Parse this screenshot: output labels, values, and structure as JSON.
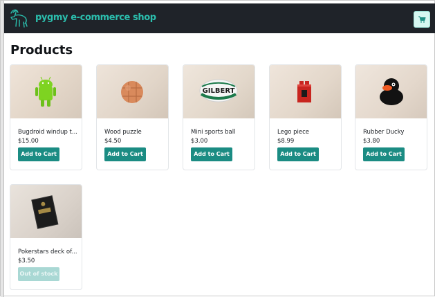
{
  "navbar": {
    "brand": "pygmy e-commerce shop",
    "logo_icon": "goat-logo-icon",
    "cart_icon": "shopping-cart-icon",
    "accent": "#2bbfae",
    "background": "#1f2329"
  },
  "page": {
    "title": "Products"
  },
  "products": [
    {
      "name": "Bugdroid windup t...",
      "price": "$15.00",
      "button": "Add to Cart",
      "in_stock": true
    },
    {
      "name": "Wood puzzle",
      "price": "$4.50",
      "button": "Add to Cart",
      "in_stock": true
    },
    {
      "name": "Mini sports ball",
      "price": "$3.00",
      "button": "Add to Cart",
      "in_stock": true,
      "image_text": "GILBERT"
    },
    {
      "name": "Lego piece",
      "price": "$8.99",
      "button": "Add to Cart",
      "in_stock": true
    },
    {
      "name": "Rubber Ducky",
      "price": "$3.80",
      "button": "Add to Cart",
      "in_stock": true
    },
    {
      "name": "Pokerstars deck of...",
      "price": "$3.50",
      "button": "Out of stock",
      "in_stock": false
    }
  ],
  "colors": {
    "button": "#1b8c83",
    "button_disabled": "#a9d8d4"
  }
}
